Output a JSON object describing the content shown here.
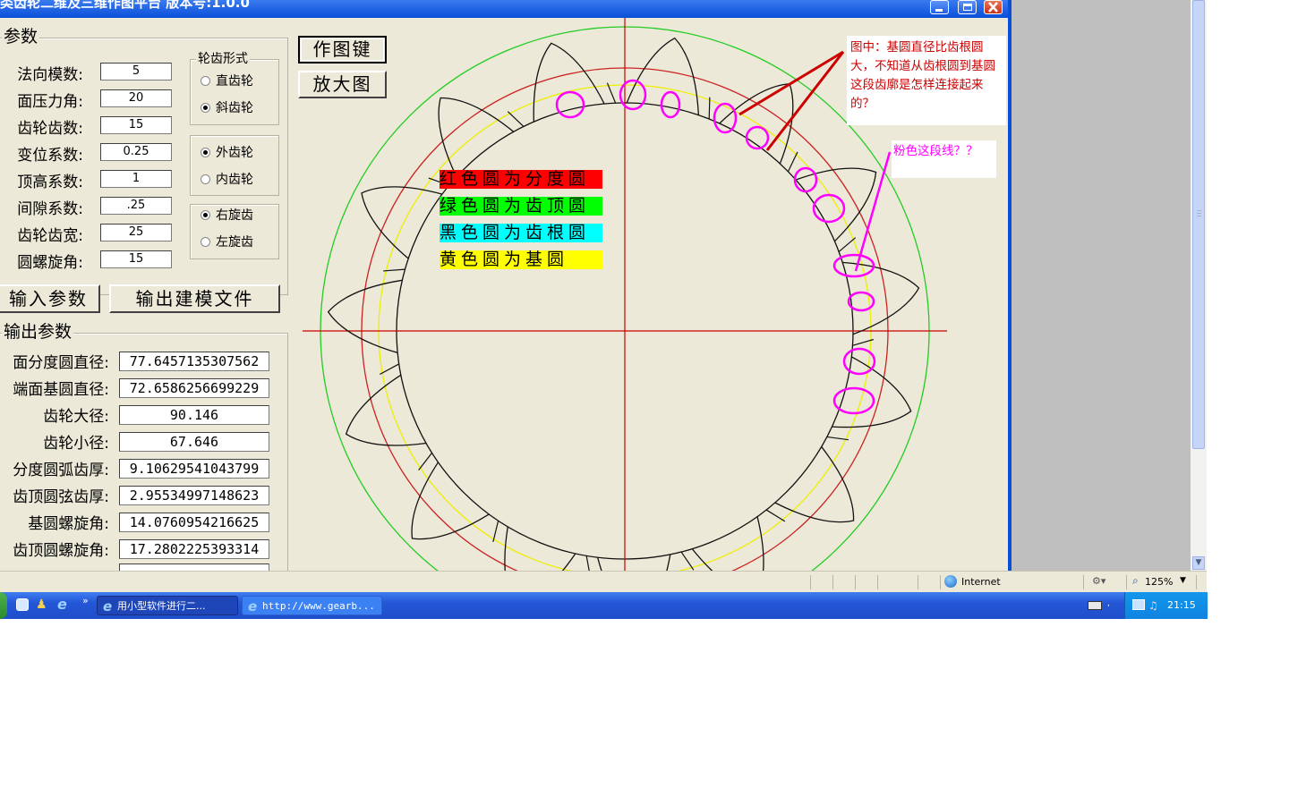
{
  "window": {
    "title": "类齿轮二维及三维作图平台  版本号:1.0.0",
    "minimize_icon": "minimize-icon",
    "maximize_icon": "maximize-icon",
    "close_icon": "close-icon"
  },
  "params": {
    "group_label": "参数",
    "fields": [
      {
        "label": "法向模数:",
        "value": "5"
      },
      {
        "label": "面压力角:",
        "value": "20"
      },
      {
        "label": "齿轮齿数:",
        "value": "15"
      },
      {
        "label": "变位系数:",
        "value": "0.25"
      },
      {
        "label": "顶高系数:",
        "value": "1"
      },
      {
        "label": "间隙系数:",
        "value": ".25"
      },
      {
        "label": "齿轮齿宽:",
        "value": "25"
      },
      {
        "label": "圆螺旋角:",
        "value": "15"
      }
    ]
  },
  "tooth_form": {
    "group_label": "轮齿形式",
    "options": [
      {
        "label": "直齿轮",
        "selected": false
      },
      {
        "label": "斜齿轮",
        "selected": true
      }
    ]
  },
  "gear_type": {
    "options": [
      {
        "label": "外齿轮",
        "selected": true
      },
      {
        "label": "内齿轮",
        "selected": false
      }
    ]
  },
  "helix_dir": {
    "options": [
      {
        "label": "右旋齿",
        "selected": true
      },
      {
        "label": "左旋齿",
        "selected": false
      }
    ]
  },
  "buttons": {
    "draw": "作图键",
    "zoom": "放大图",
    "input_params": "输入参数",
    "export_model": "输出建模文件"
  },
  "output": {
    "group_label": "输出参数",
    "fields": [
      {
        "label": "面分度圆直径:",
        "value": "77.6457135307562"
      },
      {
        "label": "端面基圆直径:",
        "value": "72.6586256699229"
      },
      {
        "label": "齿轮大径:",
        "value": "90.146"
      },
      {
        "label": "齿轮小径:",
        "value": "67.646"
      },
      {
        "label": "分度圆弧齿厚:",
        "value": "9.10629541043799"
      },
      {
        "label": "齿顶圆弦齿厚:",
        "value": "2.95534997148623"
      },
      {
        "label": "基圆螺旋角:",
        "value": "14.0760954216625"
      },
      {
        "label": "齿顶圆螺旋角:",
        "value": "17.2802225393314"
      }
    ]
  },
  "legend": [
    {
      "text": "红色圆为分度圆",
      "bg": "#ff0000"
    },
    {
      "text": "绿色圆为齿顶圆",
      "bg": "#00ff00"
    },
    {
      "text": "黑色圆为齿根圆",
      "bg": "#00ffff"
    },
    {
      "text": "黄色圆为基圆",
      "bg": "#ffff00"
    }
  ],
  "annotations": {
    "note1": "图中：基圆直径比齿根圆大，不知道从齿根圆到基圆这段齿廓是怎样连接起来的？",
    "note2": "粉色这段线？？"
  },
  "colors": {
    "pitch": "#cc2222",
    "tip": "#22cc22",
    "root": "#111111",
    "base": "#eeee00",
    "axis": "#cc0000",
    "highlight": "#ff00ff",
    "note1_text": "#cc0000",
    "note2_text": "#ff00ff"
  },
  "statusbar": {
    "zone": "Internet",
    "zoom": "125%",
    "globe_icon": "globe-icon",
    "security_icon": "security-icon",
    "zoom_icon": "magnifier-icon"
  },
  "taskbar": {
    "tasks": [
      {
        "label": "用小型软件进行二..."
      },
      {
        "label": "http://www.gearb..."
      }
    ],
    "time": "21:15"
  }
}
